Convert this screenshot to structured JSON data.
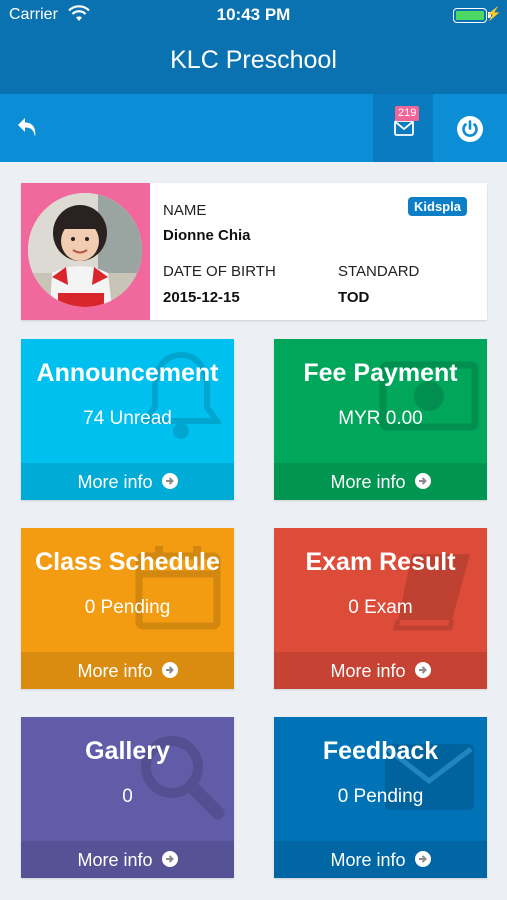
{
  "status_bar": {
    "carrier": "Carrier",
    "time": "10:43 PM",
    "battery_percent": 100
  },
  "nav": {
    "title": "KLC Preschool"
  },
  "toolbar": {
    "mail_badge": "219"
  },
  "profile": {
    "name_label": "NAME",
    "name": "Dionne Chia",
    "dob_label": "DATE OF BIRTH",
    "dob": "2015-12-15",
    "standard_label": "STANDARD",
    "standard": "TOD",
    "school_badge": "Kidspla"
  },
  "tiles": [
    {
      "title": "Announcement",
      "subtitle": "74 Unread",
      "footer": "More info",
      "color": "#00c0ef",
      "icon": "bell-icon"
    },
    {
      "title": "Fee Payment",
      "subtitle": "MYR 0.00",
      "footer": "More info",
      "color": "#00a65a",
      "icon": "money-icon"
    },
    {
      "title": "Class Schedule",
      "subtitle": "0 Pending",
      "footer": "More info",
      "color": "#f39c12",
      "icon": "calendar-icon"
    },
    {
      "title": "Exam Result",
      "subtitle": "0 Exam",
      "footer": "More info",
      "color": "#dd4b39",
      "icon": "book-icon"
    },
    {
      "title": "Gallery",
      "subtitle": "0",
      "footer": "More info",
      "color": "#605ca8",
      "icon": "search-icon"
    },
    {
      "title": "Feedback",
      "subtitle": "0 Pending",
      "footer": "More info",
      "color": "#0073b7",
      "icon": "envelope-icon"
    }
  ],
  "colors": {
    "nav_bg": "#0a72b1",
    "toolbar_bg": "#0c8ed6",
    "page_bg": "#ecf0f5",
    "profile_accent": "#f0689c",
    "badge_pink": "#f06596"
  }
}
